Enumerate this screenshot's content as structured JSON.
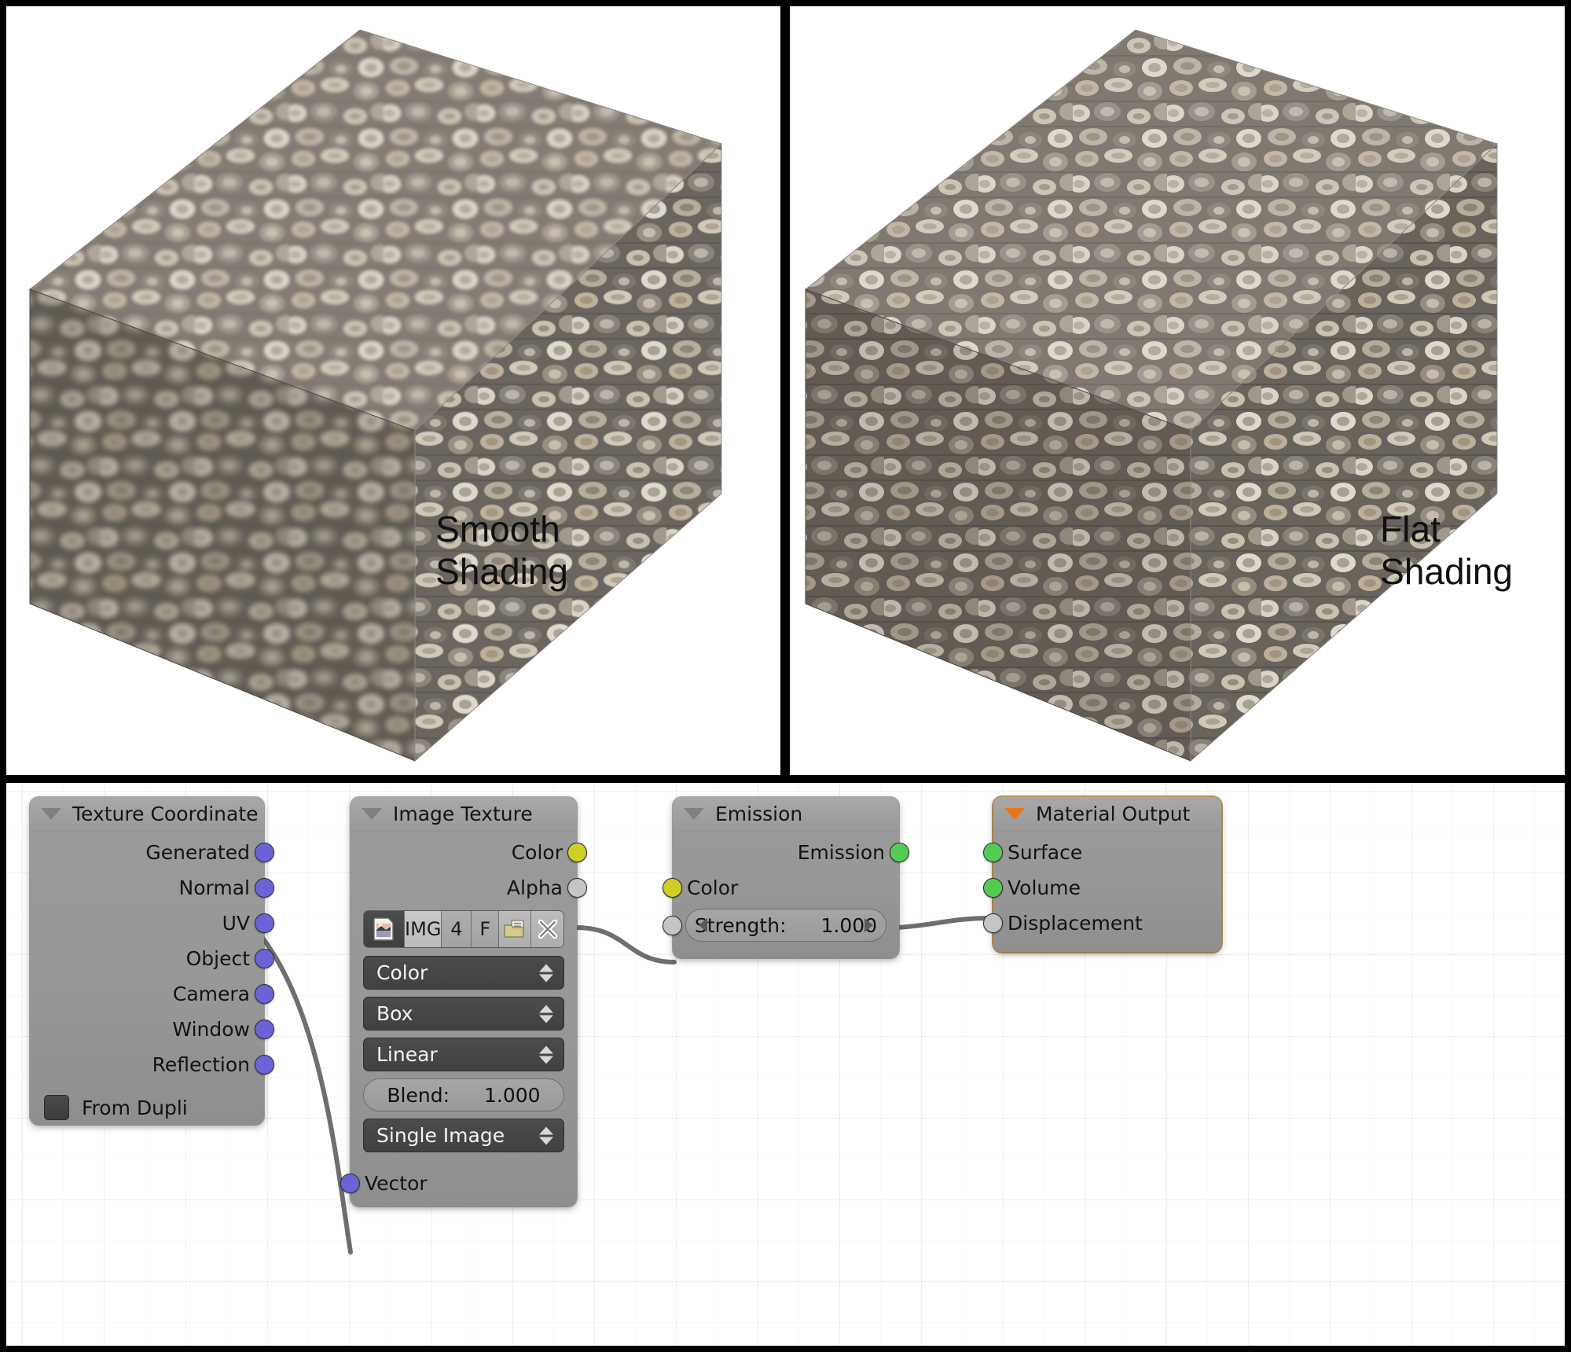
{
  "viewports": [
    {
      "id": "left",
      "label": "Smooth\nShading",
      "texture": "firewood-log-stack",
      "shading": "smooth"
    },
    {
      "id": "right",
      "label": "Flat\nShading",
      "texture": "firewood-log-stack",
      "shading": "flat"
    }
  ],
  "node_editor": {
    "background": "#ffffff",
    "grid": true,
    "nodes": [
      {
        "id": "texture_coordinate",
        "title": "Texture Coordinate",
        "selected": false,
        "collapse_icon": "triangle-down-icon",
        "outputs": [
          {
            "label": "Generated",
            "type": "vector"
          },
          {
            "label": "Normal",
            "type": "vector"
          },
          {
            "label": "UV",
            "type": "vector"
          },
          {
            "label": "Object",
            "type": "vector"
          },
          {
            "label": "Camera",
            "type": "vector"
          },
          {
            "label": "Window",
            "type": "vector"
          },
          {
            "label": "Reflection",
            "type": "vector"
          }
        ],
        "inputs": [],
        "checkbox": {
          "label": "From Dupli",
          "checked": false
        }
      },
      {
        "id": "image_texture",
        "title": "Image Texture",
        "selected": false,
        "collapse_icon": "triangle-down-icon",
        "outputs": [
          {
            "label": "Color",
            "type": "color"
          },
          {
            "label": "Alpha",
            "type": "gray"
          }
        ],
        "toolbar": {
          "browse_icon": "image-datablock-icon",
          "name": "IMG",
          "users": "4",
          "fake_user": "F",
          "open_icon": "open-folder-icon",
          "unlink_icon": "x-close-icon"
        },
        "dropdowns": [
          {
            "name": "color_space",
            "value": "Color"
          },
          {
            "name": "projection",
            "value": "Box"
          },
          {
            "name": "interpolation",
            "value": "Linear"
          }
        ],
        "slider": {
          "label": "Blend:",
          "value": "1.000"
        },
        "source_dropdown": {
          "name": "source",
          "value": "Single Image"
        },
        "inputs": [
          {
            "label": "Vector",
            "type": "vector"
          }
        ]
      },
      {
        "id": "emission",
        "title": "Emission",
        "selected": false,
        "collapse_icon": "triangle-down-icon",
        "outputs": [
          {
            "label": "Emission",
            "type": "shader"
          }
        ],
        "inputs": [
          {
            "label": "Color",
            "type": "color"
          },
          {
            "label": "",
            "type": "gray"
          }
        ],
        "slider": {
          "label": "Strength:",
          "value": "1.000"
        }
      },
      {
        "id": "material_output",
        "title": "Material Output",
        "selected": true,
        "collapse_icon": "triangle-down-orange-icon",
        "outputs": [],
        "inputs": [
          {
            "label": "Surface",
            "type": "shader"
          },
          {
            "label": "Volume",
            "type": "shader"
          },
          {
            "label": "Displacement",
            "type": "gray"
          }
        ]
      }
    ],
    "links": [
      {
        "from": "texture_coordinate.Generated",
        "to": "image_texture.Vector",
        "color": "#6a64d8"
      },
      {
        "from": "image_texture.Color",
        "to": "emission.Color",
        "color": "#cfcf26"
      },
      {
        "from": "emission.Emission",
        "to": "material_output.Surface",
        "color": "#54cc54"
      }
    ]
  },
  "colors": {
    "socket_vector": "#6a64d8",
    "socket_color": "#cfcf26",
    "socket_shader": "#54cc54",
    "socket_gray": "#c5c5c5",
    "node_body": "#979797",
    "node_header": "#a0a0a0",
    "selection_outline": "#c49a5c",
    "collapse_orange": "#e8751a"
  }
}
